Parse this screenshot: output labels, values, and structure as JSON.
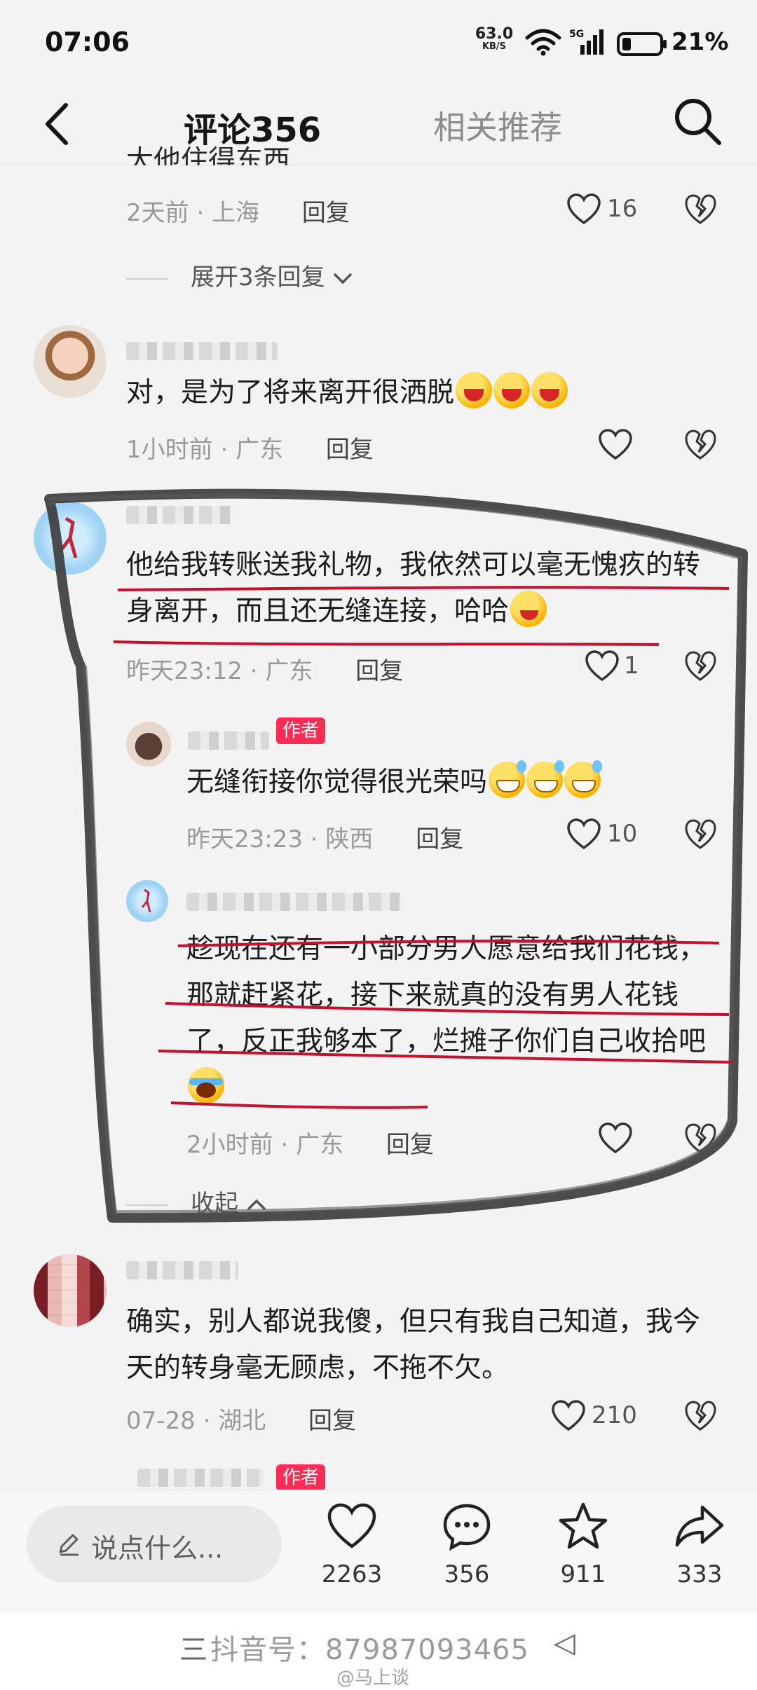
{
  "status_bar": {
    "time": "07:06",
    "net_speed": "63.0",
    "net_unit": "KB/S",
    "signal_label": "5G",
    "battery": "21%"
  },
  "header": {
    "tab_comments": "评论356",
    "tab_related": "相关推荐"
  },
  "comments": [
    {
      "partial_text": "大他住得东西",
      "time": "2天前",
      "location": "上海",
      "reply": "回复",
      "likes": "16",
      "expand": "展开3条回复"
    },
    {
      "text": "对，是为了将来离开很洒脱",
      "time": "1小时前",
      "location": "广东",
      "reply": "回复"
    },
    {
      "text": "他给我转账送我礼物，我依然可以毫无愧疚的转身离开，而且还无缝连接，哈哈",
      "time": "昨天23:12",
      "location": "广东",
      "reply": "回复",
      "likes": "1",
      "replies": [
        {
          "author_tag": "作者",
          "text": "无缝衔接你觉得很光荣吗",
          "time": "昨天23:23",
          "location": "陕西",
          "reply": "回复",
          "likes": "10"
        },
        {
          "text": "趁现在还有一小部分男人愿意给我们花钱，那就赶紧花，接下来就真的没有男人花钱了，反正我够本了，烂摊子你们自己收拾吧",
          "time": "2小时前",
          "location": "广东",
          "reply": "回复"
        }
      ],
      "collapse": "收起"
    },
    {
      "text": "确实，别人都说我傻，但只有我自己知道，我今天的转身毫无顾虑，不拖不欠。",
      "time": "07-28",
      "location": "湖北",
      "reply": "回复",
      "likes": "210"
    },
    {
      "author_tag": "作者"
    }
  ],
  "bottom_bar": {
    "input_placeholder": "说点什么...",
    "likes": "2263",
    "comments": "356",
    "favorites": "911",
    "shares": "333"
  },
  "nav": {
    "menu_glyph": "三",
    "back_glyph": "◁"
  },
  "watermark": {
    "id_text": "抖音号：87987093465",
    "weibo": "@马上谈"
  },
  "colors": {
    "accent": "#fe2c55",
    "underline": "#c8102e",
    "annotation_box": "#3a3a3a"
  }
}
